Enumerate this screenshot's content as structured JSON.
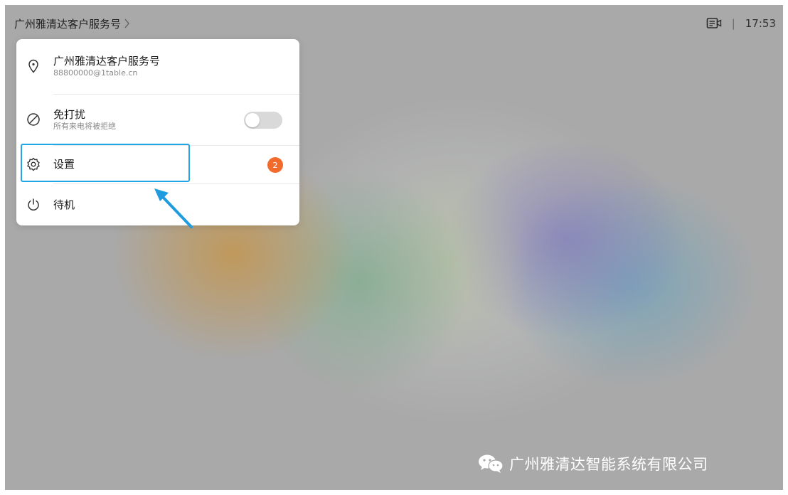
{
  "topbar": {
    "title": "广州雅清达客户服务号",
    "time": "17:53",
    "separator": "|"
  },
  "menu": {
    "account": {
      "name": "广州雅清达客户服务号",
      "address": "88800000@1table.cn"
    },
    "dnd": {
      "label": "免打扰",
      "description": "所有来电将被拒绝",
      "enabled": false
    },
    "settings": {
      "label": "设置",
      "badge": "2"
    },
    "standby": {
      "label": "待机"
    }
  },
  "annotation": {
    "highlight_color": "#22a6e8"
  },
  "watermark": {
    "text": "广州雅清达智能系统有限公司"
  },
  "colors": {
    "badge": "#f26b2d",
    "toggle_off": "#d9d9d9"
  },
  "icons": [
    "location-pin-icon",
    "no-disturb-icon",
    "gear-icon",
    "power-icon",
    "camera-icon",
    "chevron-right-icon",
    "wechat-icon"
  ]
}
